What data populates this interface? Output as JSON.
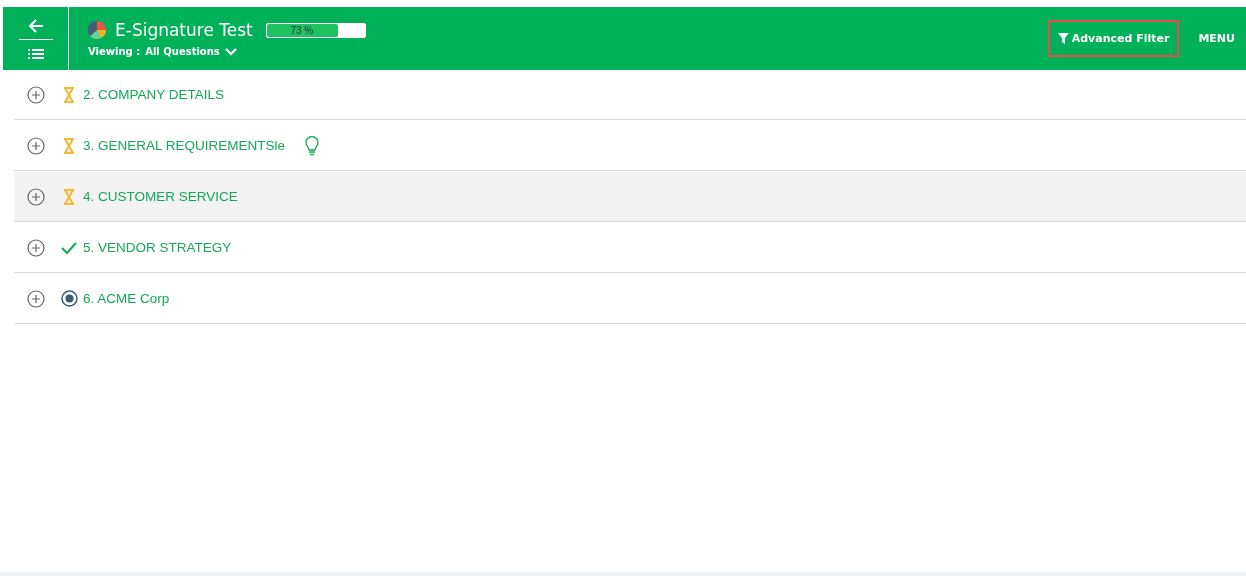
{
  "header": {
    "title": "E-Signature Test",
    "progress": {
      "level": 0.73,
      "reading": "73 %"
    },
    "viewing_label": "Viewing :",
    "viewing_value": "All Questions",
    "filter_button": "Advanced Filter",
    "menu_button": "MENU"
  },
  "sections": [
    {
      "label": "2. COMPANY DETAILS",
      "kind": "pending",
      "hint": false,
      "highlighted": false
    },
    {
      "label": "3. GENERAL REQUIREMENTSle",
      "kind": "pending",
      "hint": true,
      "highlighted": false
    },
    {
      "label": "4. CUSTOMER SERVICE",
      "kind": "pending",
      "hint": false,
      "highlighted": true
    },
    {
      "label": "5. VENDOR STRATEGY",
      "kind": "done",
      "hint": false,
      "highlighted": false
    },
    {
      "label": "6. ACME Corp",
      "kind": "current",
      "hint": false,
      "highlighted": false
    }
  ]
}
